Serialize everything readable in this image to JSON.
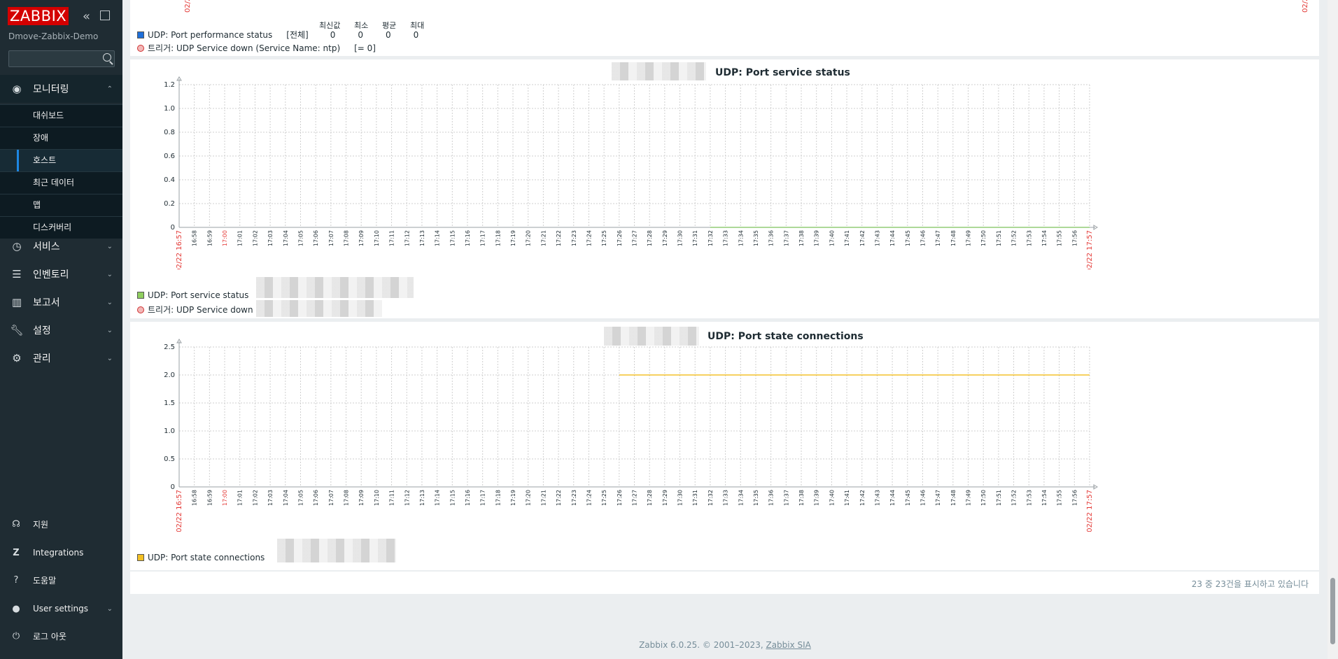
{
  "sidebar": {
    "logo": "ZABBIX",
    "server_name": "Dmove-Zabbix-Demo",
    "search_placeholder": "",
    "sections": [
      {
        "label": "모니터링",
        "icon": "eye-icon"
      },
      {
        "label": "서비스",
        "icon": "clock-icon"
      },
      {
        "label": "인벤토리",
        "icon": "list-icon"
      },
      {
        "label": "보고서",
        "icon": "chart-icon"
      },
      {
        "label": "설정",
        "icon": "wrench-icon"
      },
      {
        "label": "관리",
        "icon": "gear-icon"
      }
    ],
    "monitoring_items": [
      "대쉬보드",
      "장애",
      "호스트",
      "최근 데이터",
      "맵",
      "디스커버리"
    ],
    "selected_item": "호스트",
    "bottom": [
      {
        "label": "지원",
        "icon": "headset-icon"
      },
      {
        "label": "Integrations",
        "icon": "zabbix-z-icon"
      },
      {
        "label": "도움말",
        "icon": "question-icon"
      },
      {
        "label": "User settings",
        "icon": "user-icon"
      },
      {
        "label": "로그 아웃",
        "icon": "power-icon"
      }
    ]
  },
  "top_graph": {
    "stats_headers": [
      "최신값",
      "최소",
      "평균",
      "최대"
    ],
    "legend_item": "UDP: Port performance status",
    "legend_scope": "[전체]",
    "values": [
      "0",
      "0",
      "0",
      "0"
    ],
    "trigger": "트리거: UDP Service down (Service Name: ntp)",
    "trigger_cond": "[= 0]",
    "edge_label": "02/2"
  },
  "graphs": [
    {
      "title": "UDP: Port service status",
      "y_ticks": [
        "1.2",
        "1.0",
        "0.8",
        "0.6",
        "0.4",
        "0.2",
        "0"
      ],
      "legend_item": "UDP: Port service status",
      "trigger": "트리거: UDP Service down",
      "color": "#7cc05a"
    },
    {
      "title": "UDP: Port state connections",
      "y_ticks": [
        "2.5",
        "2.0",
        "1.5",
        "1.0",
        "0.5",
        "0"
      ],
      "legend_item": "UDP: Port state connections",
      "color": "#f0b400"
    }
  ],
  "chart_data": [
    {
      "type": "line",
      "title": "UDP: Port service status",
      "ylim": [
        0,
        1.2
      ],
      "x_start": "02/22 16:57",
      "x_end": "02/22 17:57",
      "series": [
        {
          "name": "UDP: Port service status",
          "x_start": "17:32",
          "x_end": "17:57",
          "value": 0
        }
      ]
    },
    {
      "type": "line",
      "title": "UDP: Port state connections",
      "ylim": [
        0,
        2.5
      ],
      "x_start": "02/22 16:57",
      "x_end": "02/22 17:57",
      "series": [
        {
          "name": "UDP: Port state connections",
          "x_start": "17:26",
          "x_end": "17:57",
          "value": 2
        }
      ]
    }
  ],
  "x_ticks": [
    "02/22 16:57",
    "16:58",
    "16:59",
    "17:00",
    "17:01",
    "17:02",
    "17:03",
    "17:04",
    "17:05",
    "17:06",
    "17:07",
    "17:08",
    "17:09",
    "17:10",
    "17:11",
    "17:12",
    "17:13",
    "17:14",
    "17:15",
    "17:16",
    "17:17",
    "17:18",
    "17:19",
    "17:20",
    "17:21",
    "17:22",
    "17:23",
    "17:24",
    "17:25",
    "17:26",
    "17:27",
    "17:28",
    "17:29",
    "17:30",
    "17:31",
    "17:32",
    "17:33",
    "17:34",
    "17:35",
    "17:36",
    "17:37",
    "17:38",
    "17:39",
    "17:40",
    "17:41",
    "17:42",
    "17:43",
    "17:44",
    "17:45",
    "17:46",
    "17:47",
    "17:48",
    "17:49",
    "17:50",
    "17:51",
    "17:52",
    "17:53",
    "17:54",
    "17:55",
    "17:56",
    "02/22 17:57"
  ],
  "pager_text": "23 중 23건을 표시하고 있습니다",
  "footer": {
    "text": "Zabbix 6.0.25. © 2001–2023, ",
    "link": "Zabbix SIA"
  }
}
